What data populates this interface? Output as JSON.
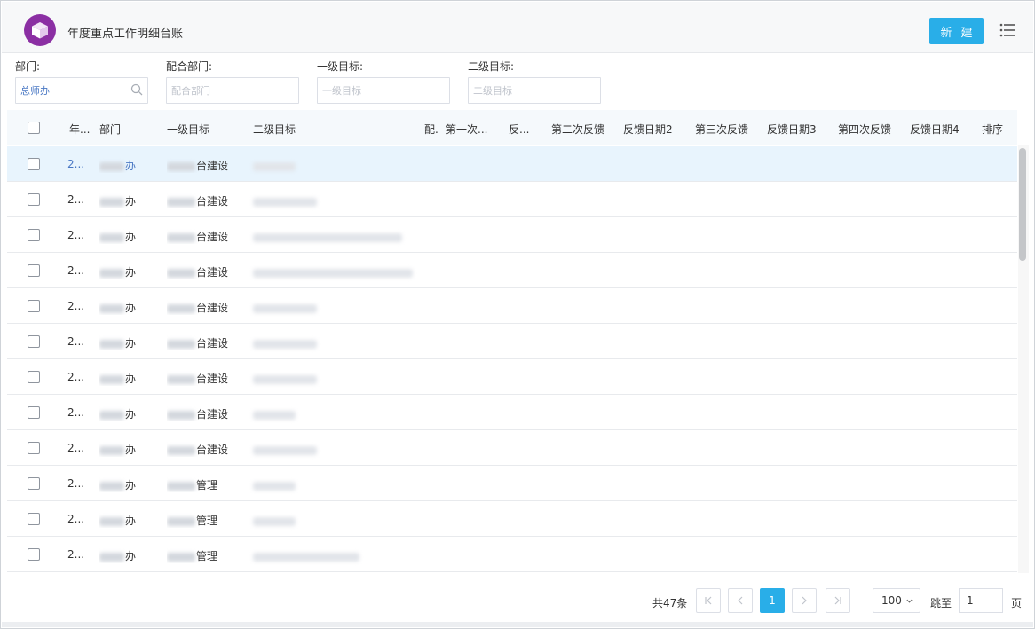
{
  "header": {
    "app_title": "年度重点工作明细台账",
    "new_button": "新 建"
  },
  "filters": {
    "dept": {
      "label": "部门:",
      "value": "总师办"
    },
    "coop_dept": {
      "label": "配合部门:",
      "placeholder": "配合部门"
    },
    "level1_goal": {
      "label": "一级目标:",
      "placeholder": "一级目标"
    },
    "level2_goal": {
      "label": "二级目标:",
      "placeholder": "二级目标"
    }
  },
  "table": {
    "columns": [
      "年...",
      "部门",
      "一级目标",
      "二级目标",
      "配.",
      "第一次...",
      "反...",
      "第二次反馈",
      "反馈日期2",
      "第三次反馈",
      "反馈日期3",
      "第四次反馈",
      "反馈日期4",
      "排序"
    ],
    "rows": [
      {
        "year": "2...",
        "dept": "办",
        "goal1": "台建设"
      },
      {
        "year": "2...",
        "dept": "办",
        "goal1": "台建设"
      },
      {
        "year": "2...",
        "dept": "办",
        "goal1": "台建设"
      },
      {
        "year": "2...",
        "dept": "办",
        "goal1": "台建设"
      },
      {
        "year": "2...",
        "dept": "办",
        "goal1": "台建设"
      },
      {
        "year": "2...",
        "dept": "办",
        "goal1": "台建设"
      },
      {
        "year": "2...",
        "dept": "办",
        "goal1": "台建设"
      },
      {
        "year": "2...",
        "dept": "办",
        "goal1": "台建设"
      },
      {
        "year": "2...",
        "dept": "办",
        "goal1": "台建设"
      },
      {
        "year": "2...",
        "dept": "办",
        "goal1": "管理"
      },
      {
        "year": "2...",
        "dept": "办",
        "goal1": "管理"
      },
      {
        "year": "2...",
        "dept": "办",
        "goal1": "管理"
      }
    ]
  },
  "pagination": {
    "total": "共47条",
    "current_page": "1",
    "page_size": "100",
    "jump_label": "跳至",
    "jump_value": "1",
    "page_unit": "页"
  },
  "colors": {
    "accent": "#29aee8",
    "logo": "#8b2fa3",
    "highlight_row": "#e8f4fd"
  }
}
